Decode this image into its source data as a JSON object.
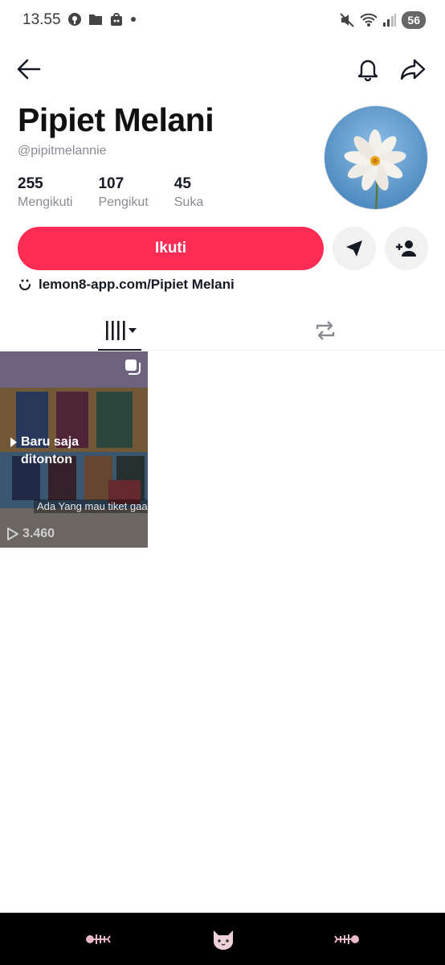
{
  "status_bar": {
    "time": "13.55",
    "battery": "56"
  },
  "profile": {
    "name": "Pipiet Melani",
    "handle": "@pipitmelannie",
    "stats": [
      {
        "value": "255",
        "label": "Mengikuti"
      },
      {
        "value": "107",
        "label": "Pengikut"
      },
      {
        "value": "45",
        "label": "Suka"
      }
    ],
    "follow_label": "Ikuti",
    "link": "lemon8-app.com/Pipiet Melani"
  },
  "video": {
    "watched_label_line1": "Baru saja",
    "watched_label_line2": "ditonton",
    "caption": "Ada Yang mau tiket gaa",
    "play_count": "3.460"
  },
  "colors": {
    "accent": "#fe2c55",
    "text": "#161823",
    "muted": "#8a8b91"
  },
  "icons": {
    "back": "arrow-left-icon",
    "bell": "bell-icon",
    "share": "share-arrow-icon",
    "message": "send-icon",
    "add_friend": "add-user-icon",
    "link": "smile-link-icon",
    "grid": "grid-bars-icon",
    "repost": "repost-icon"
  }
}
